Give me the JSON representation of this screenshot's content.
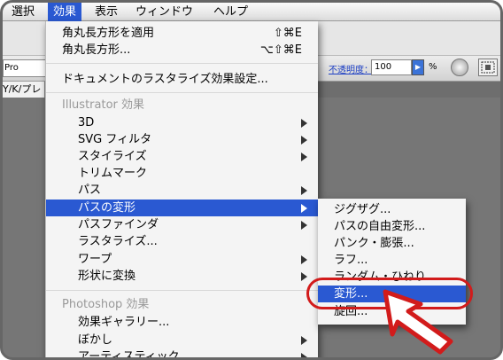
{
  "menubar": {
    "items": [
      {
        "label": "選択"
      },
      {
        "label": "効果"
      },
      {
        "label": "表示"
      },
      {
        "label": "ウィンドウ"
      },
      {
        "label": "ヘルプ"
      }
    ],
    "active_index": 1
  },
  "toolbar": {
    "style_field_value": "Pro",
    "opacity_label": "不透明度：",
    "opacity_value": "100",
    "opacity_unit": "%",
    "doc_tab_label": "Y/K/プレ"
  },
  "effect_menu": {
    "top_items": [
      {
        "label": "角丸長方形を適用",
        "shortcut": "⇧⌘E"
      },
      {
        "label": "角丸長方形...",
        "shortcut": "⌥⇧⌘E"
      },
      {
        "label": "ドキュメントのラスタライズ効果設定..."
      }
    ],
    "illustrator_header": "Illustrator 効果",
    "illustrator_items": [
      {
        "label": "3D",
        "submenu": true
      },
      {
        "label": "SVG フィルタ",
        "submenu": true
      },
      {
        "label": "スタイライズ",
        "submenu": true
      },
      {
        "label": "トリムマーク",
        "submenu": false
      },
      {
        "label": "パス",
        "submenu": true
      },
      {
        "label": "パスの変形",
        "submenu": true,
        "highlighted": true
      },
      {
        "label": "パスファインダ",
        "submenu": true
      },
      {
        "label": "ラスタライズ...",
        "submenu": false
      },
      {
        "label": "ワープ",
        "submenu": true
      },
      {
        "label": "形状に変換",
        "submenu": true
      }
    ],
    "photoshop_header": "Photoshop 効果",
    "photoshop_items": [
      {
        "label": "効果ギャラリー...",
        "submenu": false
      },
      {
        "label": "ぼかし",
        "submenu": true
      },
      {
        "label": "アーティスティック",
        "submenu": true
      }
    ]
  },
  "path_transform_submenu": {
    "items": [
      {
        "label": "ジグザグ..."
      },
      {
        "label": "パスの自由変形..."
      },
      {
        "label": "パンク・膨張..."
      },
      {
        "label": "ラフ..."
      },
      {
        "label": "ランダム・ひねり..."
      },
      {
        "label": "変形...",
        "highlighted": true
      },
      {
        "label": "旋回..."
      }
    ]
  },
  "colors": {
    "selection": "#2a59d2",
    "annotation_red": "#d21b1b"
  }
}
